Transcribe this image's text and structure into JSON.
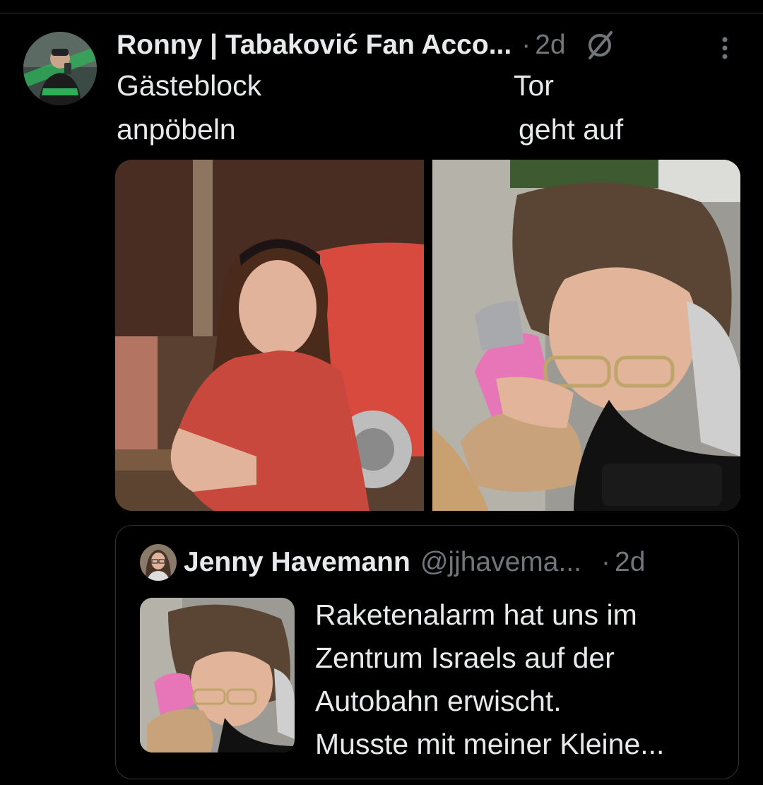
{
  "tweet": {
    "display_name": "Ronny | Tabaković Fan Acco...",
    "separator": "·",
    "time": "2d",
    "text_left": [
      "Gästeblock",
      "anpöbeln"
    ],
    "text_right": [
      "Tor",
      "geht auf"
    ],
    "media": [
      "woman-sitting-on-bench-photo",
      "woman-sheltering-child-photo"
    ]
  },
  "quoted_tweet": {
    "display_name": "Jenny Havemann",
    "handle": "@jjhavema...",
    "separator": "·",
    "time": "2d",
    "text_lines": [
      "Raketenalarm hat uns im",
      "Zentrum Israels auf der",
      "Autobahn erwischt.",
      "Musste mit meiner Kleine..."
    ]
  },
  "icons": {
    "verified": "verified-icon",
    "more": "more-options-icon"
  },
  "colors": {
    "background": "#000000",
    "text_primary": "#e7e9ea",
    "text_secondary": "#71767b",
    "border": "#2f3336"
  }
}
